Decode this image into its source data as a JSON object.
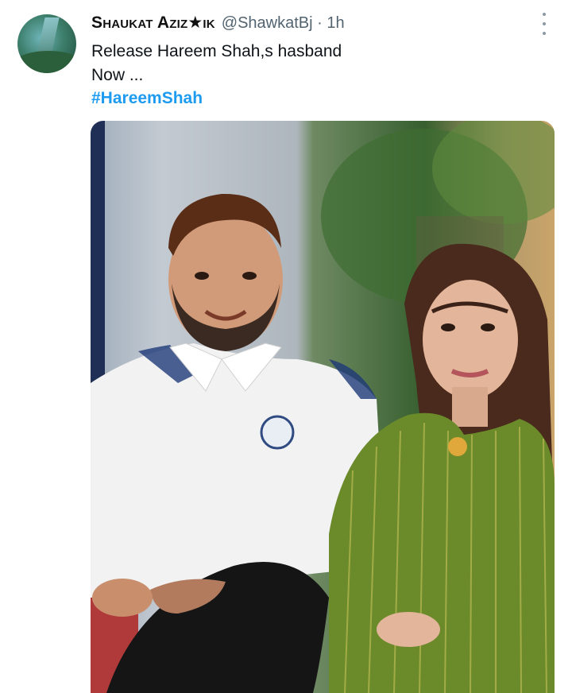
{
  "tweet": {
    "author_name": "Shaukat Aziz★ik",
    "meta": "@ShawkatBj · 1h",
    "text_line1": "Release Hareem Shah,s hasband",
    "text_line2": "Now ...",
    "hashtag": "#HareemShah"
  },
  "icons": {
    "avatar": "profile-avatar",
    "more": "more-vertical-icon"
  },
  "colors": {
    "hashtag": "#1d9bf0",
    "meta": "#536471"
  }
}
